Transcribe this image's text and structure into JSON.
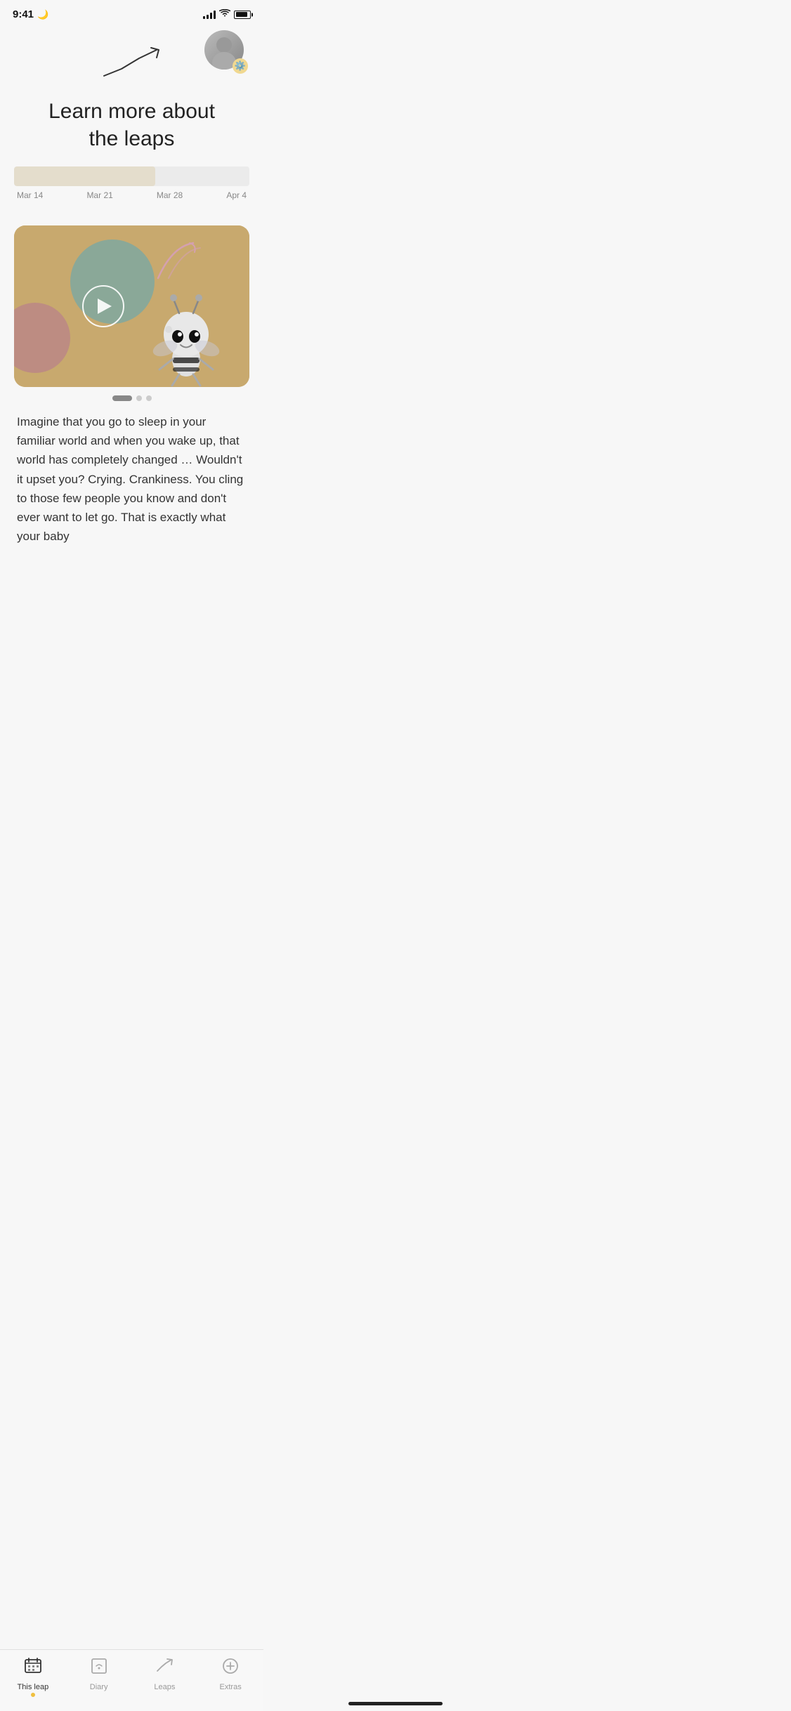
{
  "statusBar": {
    "time": "9:41",
    "moonIcon": "🌙"
  },
  "header": {
    "title": "Learn more about\nthe leaps",
    "settingsIcon": "⚙️"
  },
  "timeline": {
    "labels": [
      "Mar 14",
      "Mar 21",
      "Mar 28",
      "Apr 4"
    ]
  },
  "video": {
    "playLabel": "Play video"
  },
  "description": {
    "text": "Imagine that you go to sleep in your familiar world and when you wake up, that world has completely changed … Wouldn't it upset you? Crying. Crankiness. You cling to those few people you know and don't ever want to let go. That is exactly what your baby"
  },
  "bottomNav": {
    "items": [
      {
        "id": "this-leap",
        "label": "This leap",
        "active": true
      },
      {
        "id": "diary",
        "label": "Diary",
        "active": false
      },
      {
        "id": "leaps",
        "label": "Leaps",
        "active": false
      },
      {
        "id": "extras",
        "label": "Extras",
        "active": false
      }
    ]
  }
}
